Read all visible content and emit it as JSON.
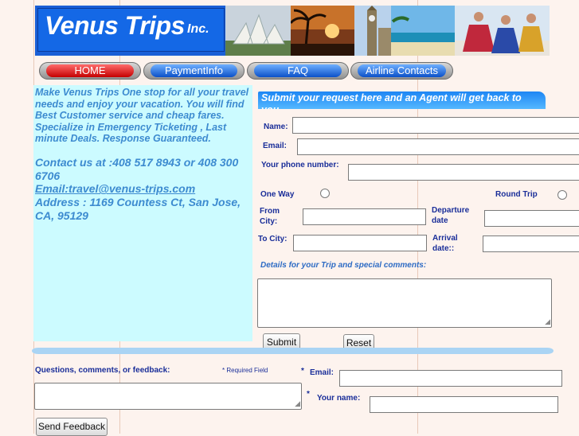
{
  "banner": {
    "logo_main": "Venus Trips",
    "logo_suffix": "Inc.",
    "photos": [
      "temple-photo",
      "palm-sunset-photo",
      "big-ben-photo",
      "beach-photo",
      "dancers-photo"
    ]
  },
  "nav": {
    "items": [
      {
        "label": "HOME",
        "active": true
      },
      {
        "label": "PaymentInfo"
      },
      {
        "label": "FAQ"
      },
      {
        "label": "Airline Contacts"
      }
    ]
  },
  "info": {
    "intro": "Make Venus Trips One stop for all your travel needs and enjoy your vacation. You will find Best Customer service and cheap fares. Specialize in Emergency Ticketing , Last minute Deals. Response Guaranteed.",
    "contact": "Contact us at :408 517 8943 or 408 300 6706",
    "email": "Email:travel@venus-trips.com",
    "address": "Address : 1169 Countess Ct, San Jose, CA, 95129"
  },
  "request_form": {
    "heading": "Submit your request here and an Agent will get back to you",
    "name_label": "Name:",
    "email_label": "Email:",
    "phone_label": "Your phone number:",
    "one_way_label": "One Way",
    "round_trip_label": "Round Trip",
    "from_city_label": "From City:",
    "departure_label": "Departure date",
    "to_city_label": "To City:",
    "arrival_label": "Arrival date::",
    "details_label": "Details for your Trip and special comments:",
    "submit_label": "Submit",
    "reset_label": "Reset"
  },
  "feedback": {
    "questions_label": "Questions, comments, or feedback:",
    "required_note": "* Required Field",
    "email_star": "*",
    "email_label": "Email:",
    "name_star": "*",
    "name_label": "Your name:",
    "send_label": "Send Feedback"
  },
  "colors": {
    "page_bg": "#fdf3ee",
    "banner_blue": "#1a5fd6",
    "info_bg": "#ccfbff",
    "info_text": "#3d8bd0",
    "label_blue": "#1a2e99",
    "nav_home": "#e00000",
    "nav_other": "#1a6ee0"
  }
}
